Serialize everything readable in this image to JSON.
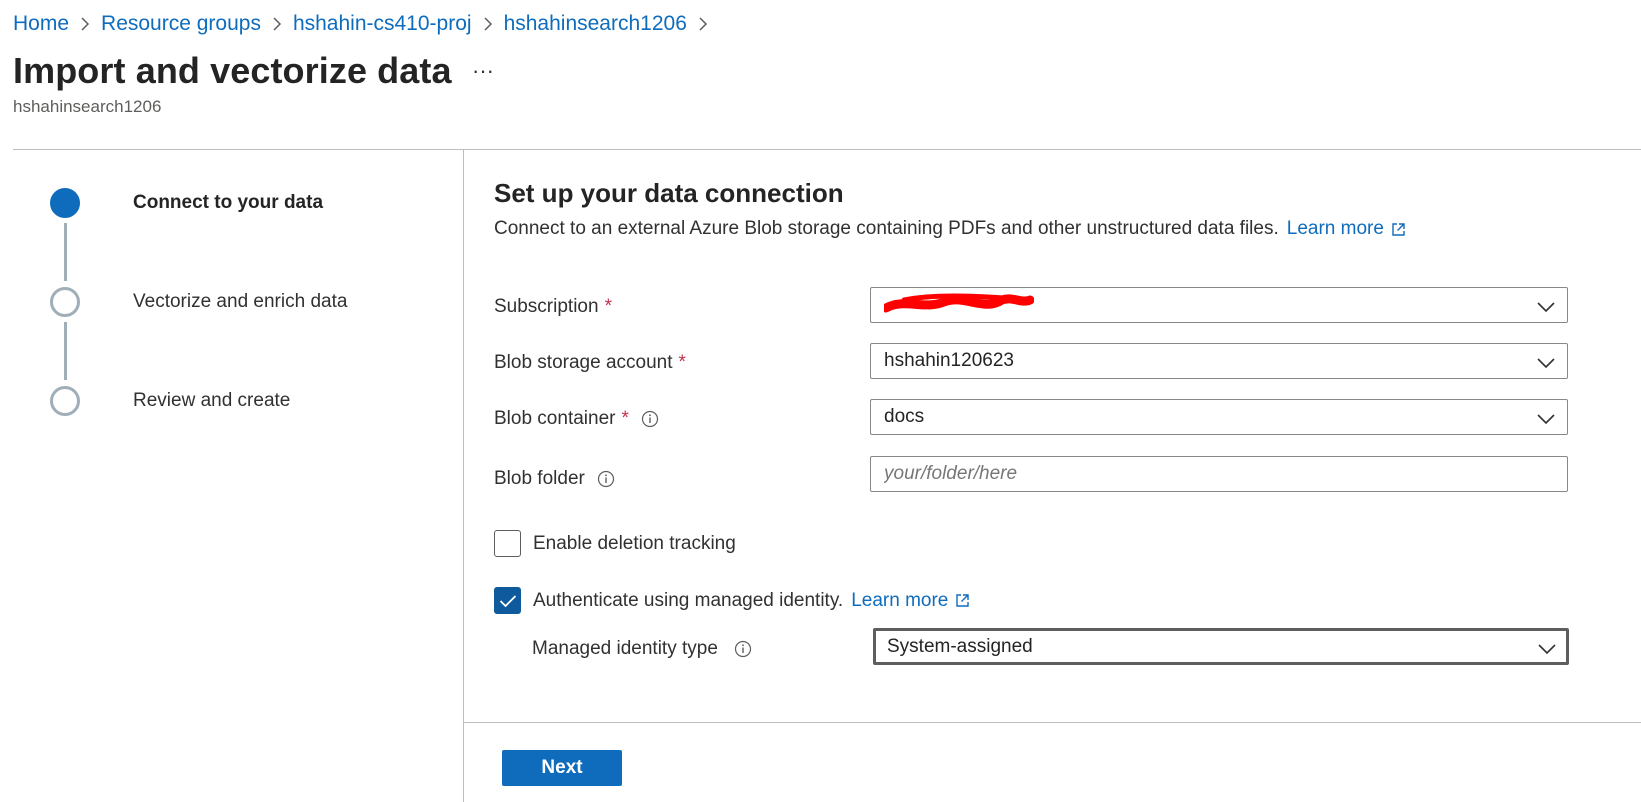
{
  "breadcrumb": {
    "items": [
      "Home",
      "Resource groups",
      "hshahin-cs410-proj",
      "hshahinsearch1206"
    ]
  },
  "page": {
    "title": "Import and vectorize data",
    "more": "···",
    "subtitle": "hshahinsearch1206"
  },
  "steps": [
    {
      "label": "Connect to your data",
      "state": "active"
    },
    {
      "label": "Vectorize and enrich data",
      "state": "pending"
    },
    {
      "label": "Review and create",
      "state": "pending"
    }
  ],
  "section": {
    "title": "Set up your data connection",
    "description": "Connect to an external Azure Blob storage containing PDFs and other unstructured data files.",
    "learn_more": "Learn more"
  },
  "form": {
    "subscription": {
      "label": "Subscription",
      "required": "*",
      "value": "",
      "redacted": true
    },
    "storage_account": {
      "label": "Blob storage account",
      "required": "*",
      "value": "hshahin120623"
    },
    "container": {
      "label": "Blob container",
      "required": "*",
      "value": "docs"
    },
    "folder": {
      "label": "Blob folder",
      "placeholder": "your/folder/here",
      "value": ""
    },
    "deletion_tracking": {
      "label": "Enable deletion tracking",
      "checked": false
    },
    "managed_identity": {
      "label": "Authenticate using managed identity.",
      "learn_more": "Learn more",
      "checked": true
    },
    "identity_type": {
      "label": "Managed identity type",
      "value": "System-assigned"
    }
  },
  "footer": {
    "next_label": "Next"
  },
  "colors": {
    "accent": "#0f6cbd",
    "required": "#c4314b",
    "checkbox_checked": "#0f5a9c",
    "redaction": "#ff0000"
  },
  "icons": [
    "chevron-right-icon",
    "chevron-down-icon",
    "info-icon",
    "external-link-icon",
    "checkmark-icon",
    "more-icon"
  ]
}
